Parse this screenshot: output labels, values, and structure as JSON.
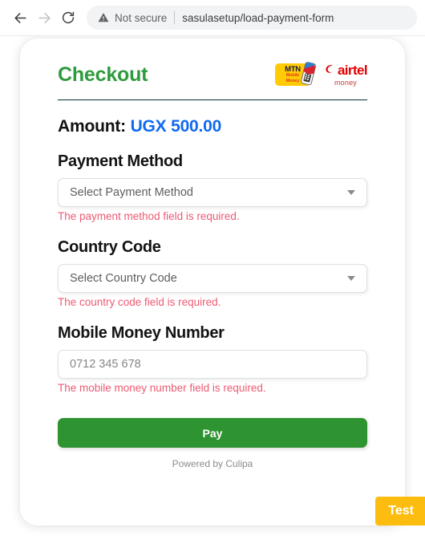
{
  "browser": {
    "back_icon": "arrow-left-icon",
    "forward_icon": "arrow-right-icon",
    "reload_icon": "reload-icon",
    "security_icon": "warning-triangle-icon",
    "security_label": "Not secure",
    "url": "sasulasetup/load-payment-form"
  },
  "card": {
    "title": "Checkout",
    "title_color": "#2e9b3d",
    "logos": {
      "mtn": {
        "name": "mtn-mobile-money-logo",
        "line1": "MTN",
        "line2": "Mobile",
        "line3": "Money",
        "plate_color": "#ffcb05",
        "text_color": "#1a1a3c",
        "sub_color": "#e03a1e"
      },
      "airtel": {
        "name": "airtel-money-logo",
        "word": "airtel",
        "sub": "money",
        "color": "#e40000"
      }
    },
    "amount": {
      "label": "Amount:",
      "value": "UGX 500.00",
      "value_color": "#1169f0"
    },
    "fields": [
      {
        "name": "payment-method",
        "label": "Payment Method",
        "type": "select",
        "value": "Select Payment Method",
        "error": "The payment method field is required."
      },
      {
        "name": "country-code",
        "label": "Country Code",
        "type": "select",
        "value": "Select Country Code",
        "error": "The country code field is required."
      },
      {
        "name": "mobile-money-number",
        "label": "Mobile Money Number",
        "type": "input",
        "value": "",
        "placeholder": "0712 345 678",
        "error": "The mobile money number field is required."
      }
    ],
    "pay_button": {
      "label": "Pay",
      "color": "#2e9331"
    },
    "footer": "Powered by Culipa",
    "error_color": "#ee5a72"
  },
  "test_badge": {
    "label": "Test",
    "color": "#fdbd10"
  }
}
